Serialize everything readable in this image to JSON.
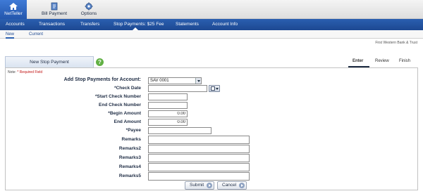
{
  "topbar": {
    "items": [
      {
        "label": "NetTeller",
        "icon": "home-icon"
      },
      {
        "label": "Bill Payment",
        "icon": "bill-payment-icon"
      },
      {
        "label": "Options",
        "icon": "gear-icon"
      }
    ]
  },
  "mainnav": {
    "items": [
      "Accounts",
      "Transactions",
      "Transfers",
      "Stop Payments: $25 Fee",
      "Statements",
      "Account Info"
    ]
  },
  "subnav": {
    "items": [
      "New",
      "Current"
    ]
  },
  "institution": "First Western Bank & Trust",
  "tab": {
    "label": "New Stop Payment"
  },
  "steps": [
    "Enter",
    "Review",
    "Finish"
  ],
  "form": {
    "note_prefix": "Note:",
    "note_required": "* Required Field",
    "account_label": "Add Stop Payments for Account:",
    "account_value": "SAV 0001",
    "check_date_label": "*Check Date",
    "start_check_label": "*Start Check Number",
    "end_check_label": "End Check Number",
    "begin_amount_label": "*Begin Amount",
    "begin_amount_value": "0.00",
    "end_amount_label": "End Amount",
    "end_amount_value": "0.00",
    "payee_label": "*Payee",
    "remarks_label": "Remarks",
    "remarks2_label": "Remarks2",
    "remarks3_label": "Remarks3",
    "remarks4_label": "Remarks4",
    "remarks5_label": "Remarks5",
    "submit_label": "Submit",
    "cancel_label": "Cancel"
  },
  "colors": {
    "nav_blue": "#1d4891",
    "active_tab_blue": "#2457ad",
    "help_green": "#61b044",
    "required_red": "#c01010"
  }
}
